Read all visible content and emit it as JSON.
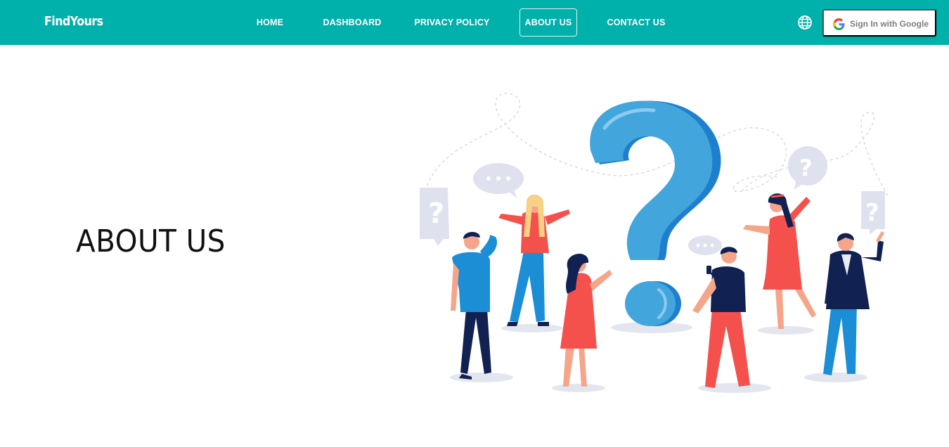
{
  "brand": {
    "name": "FindYours"
  },
  "nav": {
    "items": [
      {
        "label": "HOME",
        "active": false
      },
      {
        "label": "DASHBOARD",
        "active": false
      },
      {
        "label": "PRIVACY POLICY",
        "active": false
      },
      {
        "label": "ABOUT US",
        "active": true
      },
      {
        "label": "CONTACT US",
        "active": false
      }
    ],
    "language_icon": "globe-icon",
    "signin_label": "Sign In with Google",
    "signin_icon": "google-g-icon"
  },
  "hero": {
    "title": "ABOUT US"
  },
  "colors": {
    "navbar": "#00b0ab",
    "question_mark": "#42a5dc",
    "accent_red": "#f4514d",
    "navy": "#102152",
    "bubble": "#dfe2ee"
  }
}
